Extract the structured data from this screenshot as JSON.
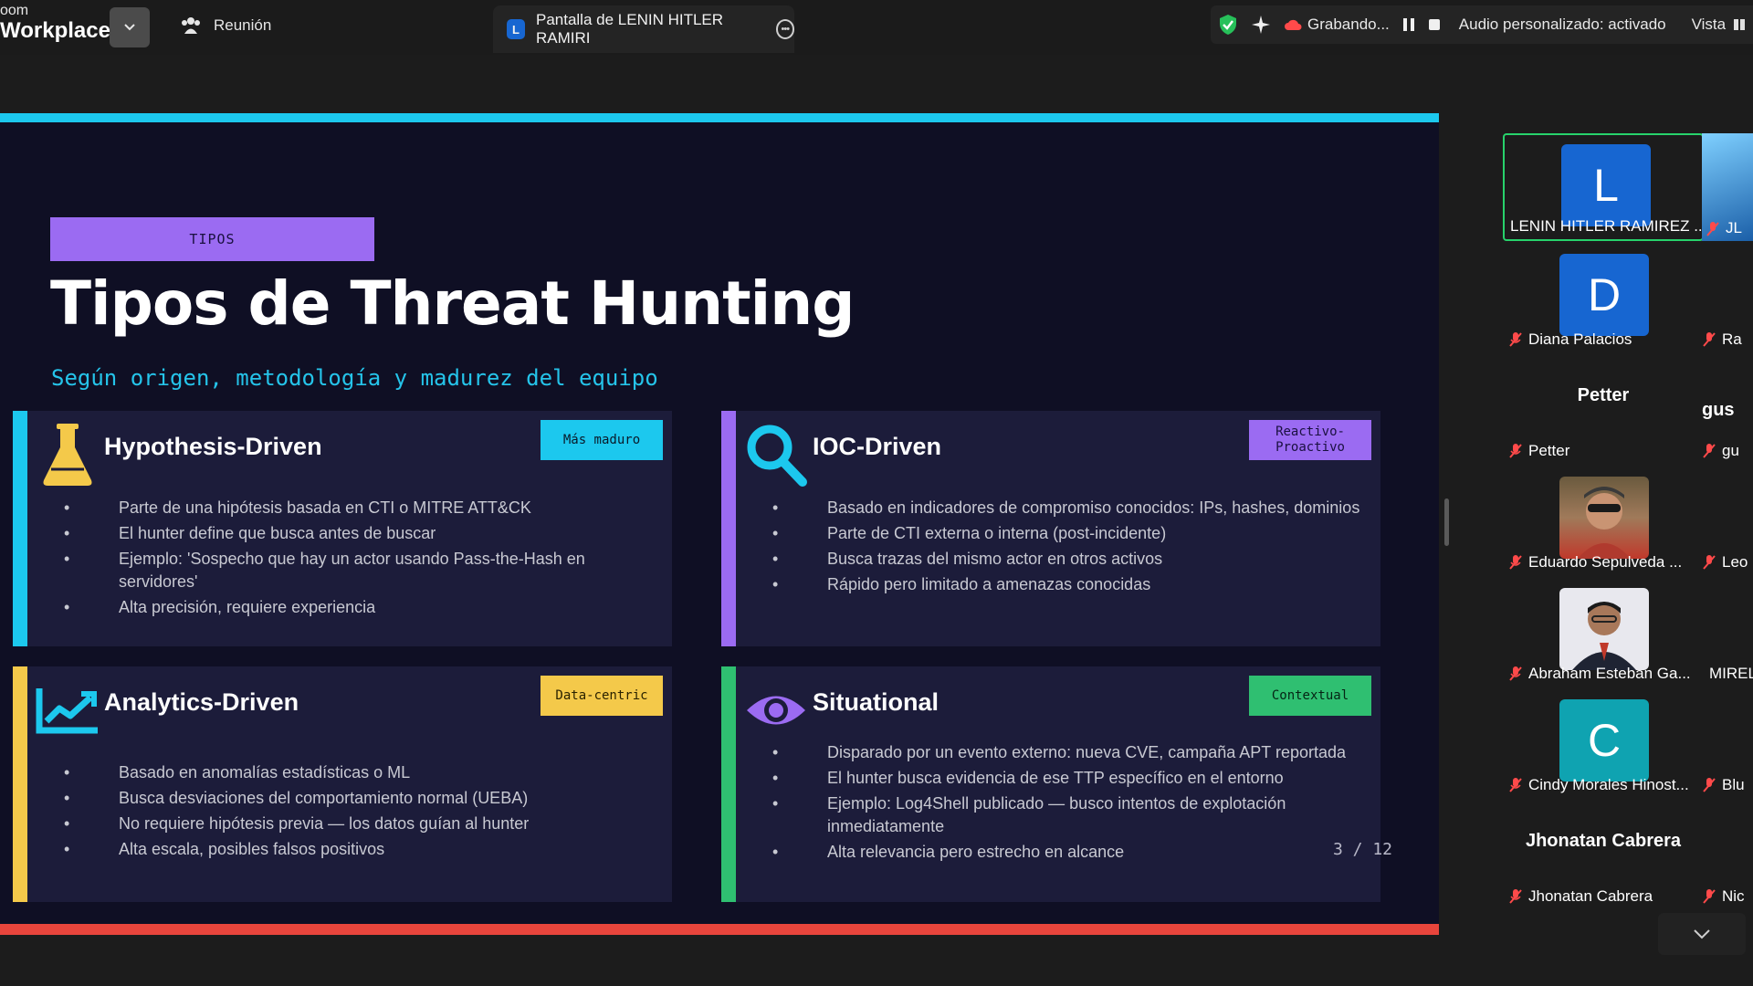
{
  "app": {
    "brand_top": "oom",
    "brand_bottom": "Workplace"
  },
  "topbar": {
    "meeting_label": "Reunión",
    "share_tab_label": "Pantalla de LENIN HITLER RAMIRI",
    "share_tab_badge": "L",
    "recording_label": "Grabando...",
    "audio_label": "Audio personalizado: activado",
    "view_label": "Vista"
  },
  "slide": {
    "tag": "TIPOS",
    "title": "Tipos de Threat Hunting",
    "subtitle": "Según origen, metodología y madurez del equipo",
    "page": "3 / 12",
    "colors": {
      "cyan": "#1cc8ee",
      "purple": "#9b6bf2",
      "yellow": "#f4c94a",
      "green": "#2fbf71",
      "red": "#e8453c"
    },
    "cards": [
      {
        "title": "Hypothesis-Driven",
        "badge": "Más maduro",
        "icon": "flask-icon",
        "bullets": [
          "Parte de una hipótesis basada en CTI o MITRE ATT&CK",
          "El hunter define que busca antes de buscar",
          "Ejemplo: 'Sospecho que hay un actor usando Pass-the-Hash en servidores'",
          "Alta precisión, requiere experiencia"
        ]
      },
      {
        "title": "IOC-Driven",
        "badge": "Reactivo-Proactivo",
        "badge_line1": "Reactivo-",
        "badge_line2": "Proactivo",
        "icon": "magnifier-icon",
        "bullets": [
          "Basado en indicadores de compromiso conocidos: IPs, hashes, dominios",
          "Parte de CTI externa o interna (post-incidente)",
          "Busca trazas del mismo actor en otros activos",
          "Rápido pero limitado a amenazas conocidas"
        ]
      },
      {
        "title": "Analytics-Driven",
        "badge": "Data-centric",
        "icon": "trend-chart-icon",
        "bullets": [
          "Basado en anomalías estadísticas o ML",
          "Busca desviaciones del comportamiento normal (UEBA)",
          "No requiere hipótesis previa — los datos guían al hunter",
          "Alta escala, posibles falsos positivos"
        ]
      },
      {
        "title": "Situational",
        "badge": "Contextual",
        "icon": "eye-icon",
        "bullets": [
          "Disparado por un evento externo: nueva CVE, campaña APT reportada",
          "El hunter busca evidencia de ese TTP específico en el entorno",
          "Ejemplo: Log4Shell publicado — busco intentos de explotación inmediatamente",
          "Alta relevancia pero estrecho en alcance"
        ]
      }
    ]
  },
  "participants": {
    "tiles": [
      {
        "name": "LENIN HITLER RAMIREZ ...",
        "initial": "L",
        "color": "#1766d1",
        "selected": true
      },
      {
        "name": "Diana Palacios",
        "initial": "D",
        "color": "#1766d1"
      },
      {
        "name": "Petter",
        "big": "Petter"
      },
      {
        "name": "Eduardo Sepulveda ...",
        "photo": "person-photo"
      },
      {
        "name": "Abraham Esteban Ga...",
        "photo": "person-photo"
      },
      {
        "name": "Cindy Morales Hinost...",
        "initial": "C",
        "color": "#0fa3b1"
      },
      {
        "name": "Jhonatan Cabrera",
        "big": "Jhonatan Cabrera"
      }
    ],
    "edge": [
      "JL",
      "Ra",
      "gus",
      "gu",
      "Leo",
      "MIREL",
      "Blu",
      "Nic"
    ]
  }
}
